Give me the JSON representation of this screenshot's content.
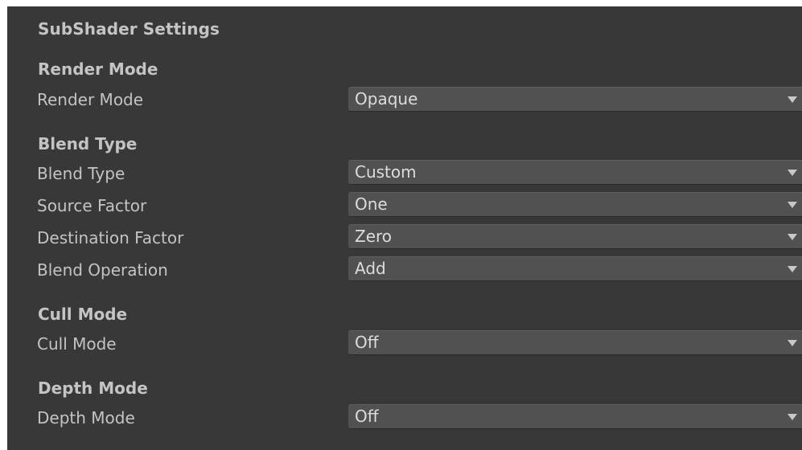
{
  "panel": {
    "title": "SubShader Settings"
  },
  "sections": {
    "render_mode": {
      "header": "Render Mode",
      "rows": [
        {
          "label": "Render Mode",
          "value": "Opaque"
        }
      ]
    },
    "blend_type": {
      "header": "Blend Type",
      "rows": [
        {
          "label": "Blend Type",
          "value": "Custom"
        },
        {
          "label": "Source Factor",
          "value": "One"
        },
        {
          "label": "Destination Factor",
          "value": "Zero"
        },
        {
          "label": "Blend Operation",
          "value": "Add"
        }
      ]
    },
    "cull_mode": {
      "header": "Cull Mode",
      "rows": [
        {
          "label": "Cull Mode",
          "value": "Off"
        }
      ]
    },
    "depth_mode": {
      "header": "Depth Mode",
      "rows": [
        {
          "label": "Depth Mode",
          "value": "Off"
        }
      ]
    }
  },
  "icons": {
    "dropdown_arrow": "chevron-down-icon"
  },
  "colors": {
    "panel_background": "#383838",
    "dropdown_background": "#515151",
    "text": "#c4c4c4"
  }
}
